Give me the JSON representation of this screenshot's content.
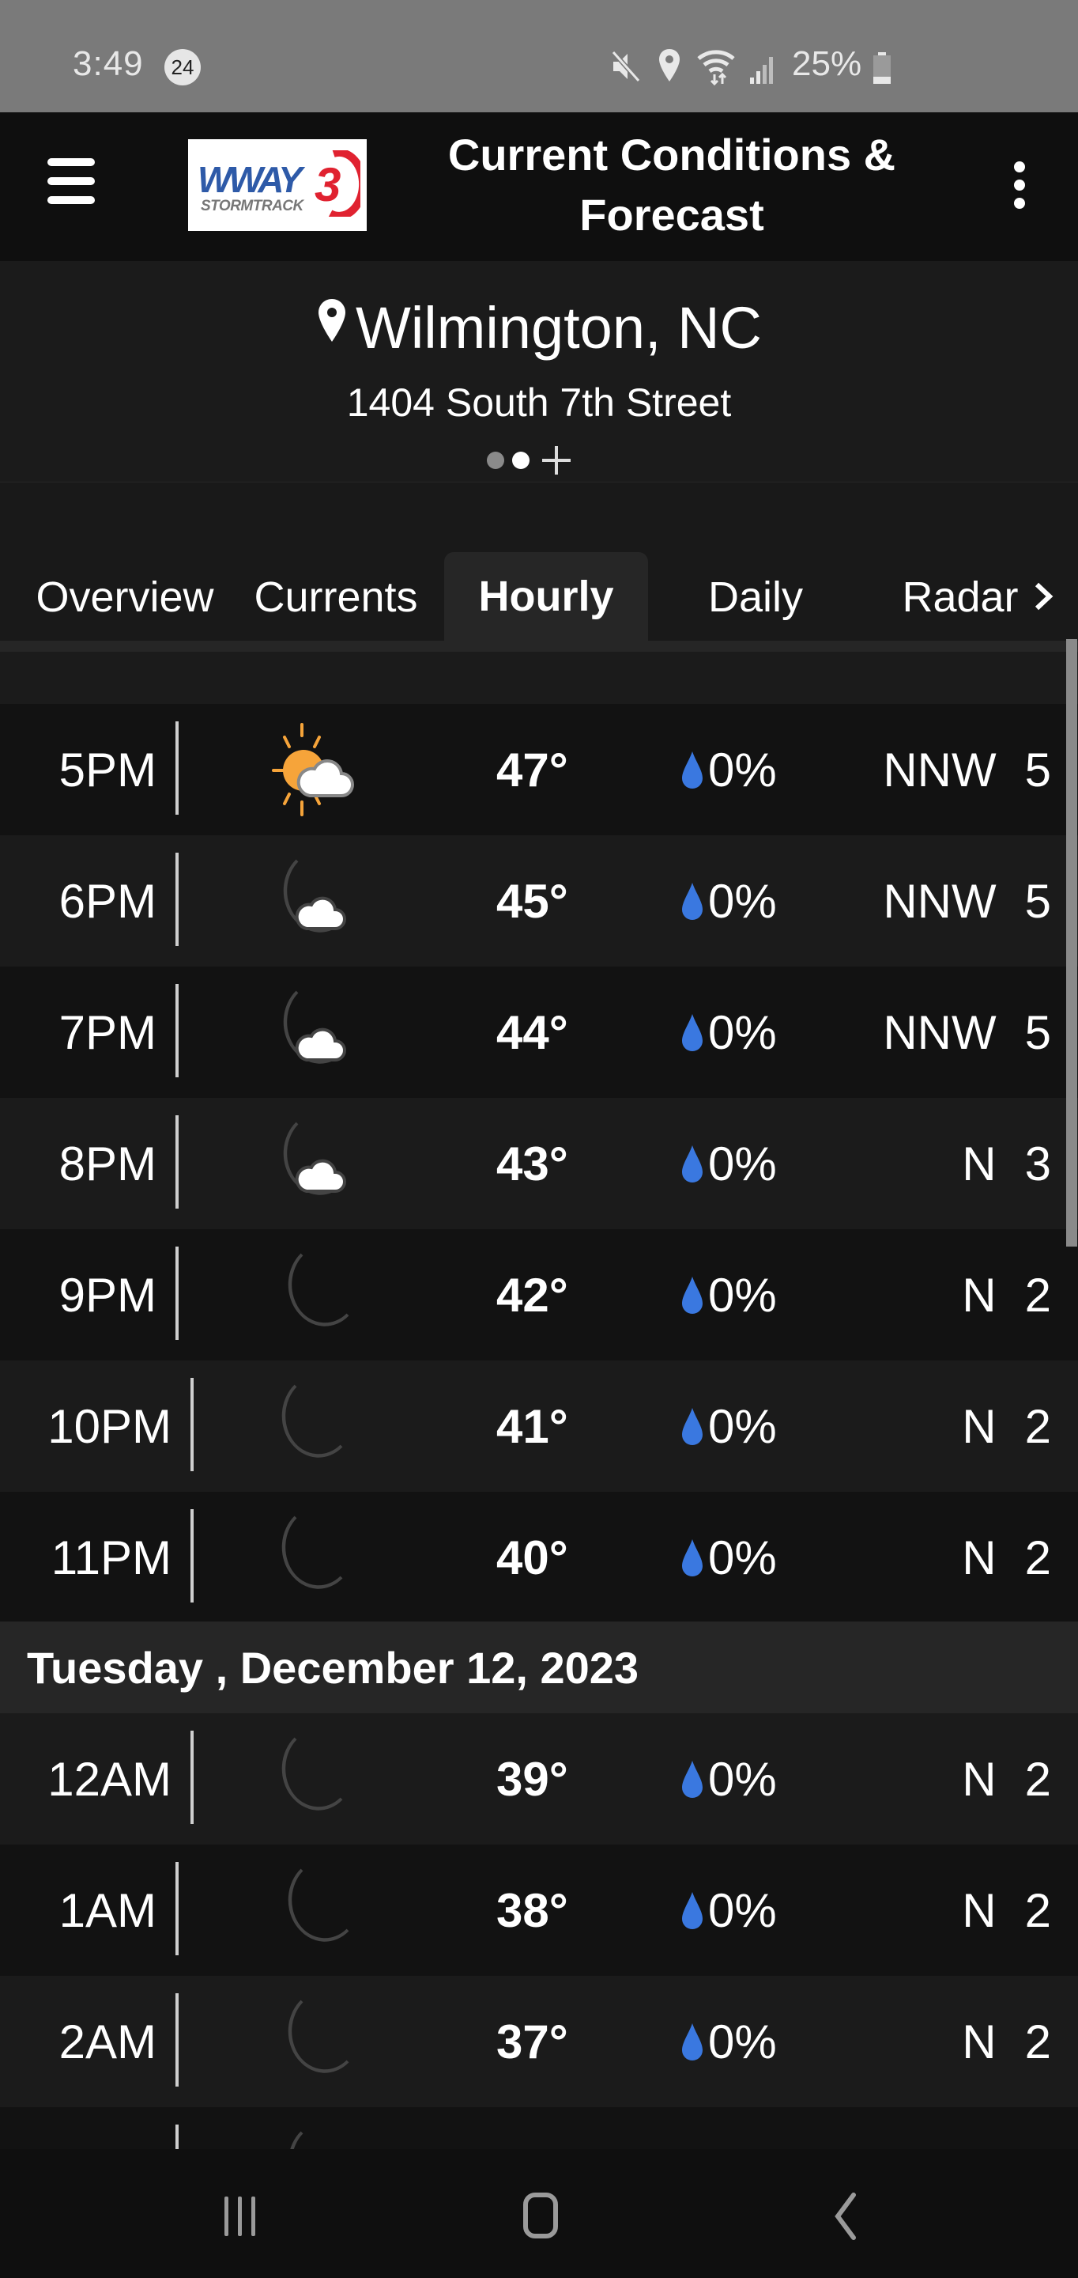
{
  "status_bar": {
    "time": "3:49",
    "notification_count": "24",
    "battery_percent": "25%",
    "battery_level": 0.25,
    "icons": [
      "mute-icon",
      "location-icon",
      "wifi-icon",
      "signal-icon",
      "battery-icon"
    ]
  },
  "app_bar": {
    "title": "Current Conditions & Forecast",
    "logo_text": "WWAY",
    "logo_subtext": "STORMTRACK",
    "logo_number": "3",
    "brand_colors": {
      "blue": "#2e5aa8",
      "red": "#e02230",
      "gray": "#777777"
    }
  },
  "location": {
    "city": "Wilmington, NC",
    "address": "1404 South 7th Street",
    "pages": 2,
    "active_page": 2
  },
  "tabs": [
    {
      "label": "Overview",
      "active": false
    },
    {
      "label": "Currents",
      "active": false
    },
    {
      "label": "Hourly",
      "active": true
    },
    {
      "label": "Daily",
      "active": false
    },
    {
      "label": "Radar",
      "active": false
    }
  ],
  "colors": {
    "precip_drop": "#3a78e0",
    "moon": "#f9d36b",
    "sun": "#f6a43a"
  },
  "hourly": [
    {
      "time": "5PM",
      "icon": "partly-sunny-icon",
      "temp": "47°",
      "precip": "0%",
      "wind_dir": "NNW",
      "wind_speed": "5"
    },
    {
      "time": "6PM",
      "icon": "partly-cloudy-night-icon",
      "temp": "45°",
      "precip": "0%",
      "wind_dir": "NNW",
      "wind_speed": "5"
    },
    {
      "time": "7PM",
      "icon": "partly-cloudy-night-icon",
      "temp": "44°",
      "precip": "0%",
      "wind_dir": "NNW",
      "wind_speed": "5"
    },
    {
      "time": "8PM",
      "icon": "partly-cloudy-night-icon",
      "temp": "43°",
      "precip": "0%",
      "wind_dir": "N",
      "wind_speed": "3"
    },
    {
      "time": "9PM",
      "icon": "clear-night-icon",
      "temp": "42°",
      "precip": "0%",
      "wind_dir": "N",
      "wind_speed": "2"
    },
    {
      "time": "10PM",
      "icon": "clear-night-icon",
      "temp": "41°",
      "precip": "0%",
      "wind_dir": "N",
      "wind_speed": "2"
    },
    {
      "time": "11PM",
      "icon": "clear-night-icon",
      "temp": "40°",
      "precip": "0%",
      "wind_dir": "N",
      "wind_speed": "2"
    }
  ],
  "date_header": "Tuesday , December 12, 2023",
  "hourly_next_day": [
    {
      "time": "12AM",
      "icon": "clear-night-icon",
      "temp": "39°",
      "precip": "0%",
      "wind_dir": "N",
      "wind_speed": "2"
    },
    {
      "time": "1AM",
      "icon": "clear-night-icon",
      "temp": "38°",
      "precip": "0%",
      "wind_dir": "N",
      "wind_speed": "2"
    },
    {
      "time": "2AM",
      "icon": "clear-night-icon",
      "temp": "37°",
      "precip": "0%",
      "wind_dir": "N",
      "wind_speed": "2"
    },
    {
      "time": "",
      "icon": "clear-night-icon",
      "temp": "",
      "precip": "",
      "wind_dir": "",
      "wind_speed": ""
    }
  ],
  "nav_bar": {
    "buttons": [
      "recent-apps",
      "home",
      "back"
    ]
  }
}
